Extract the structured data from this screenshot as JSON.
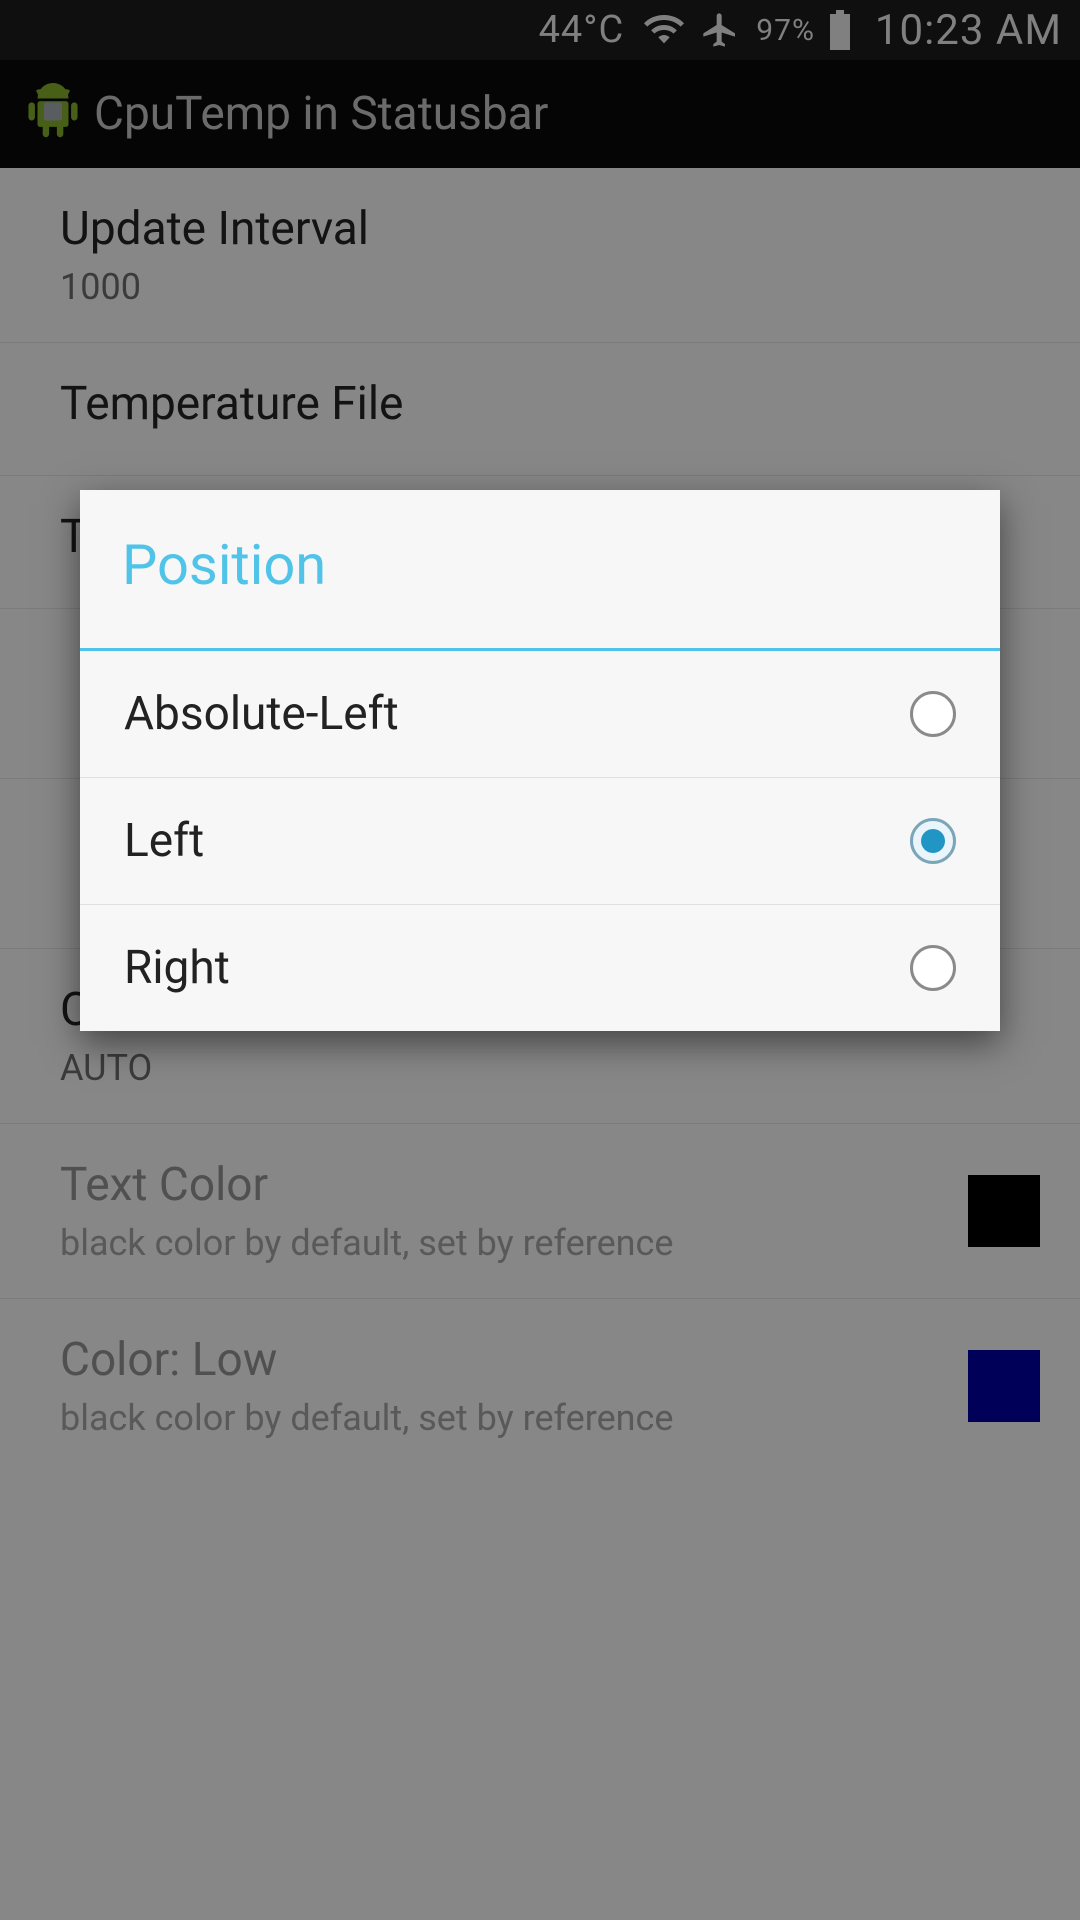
{
  "statusbar": {
    "temp": "44°C",
    "battery_pct": "97%",
    "clock": "10:23 AM"
  },
  "actionbar": {
    "title": "CpuTemp in Statusbar"
  },
  "settings": [
    {
      "label": "Update Interval",
      "value": "1000"
    },
    {
      "label": "Temperature File",
      "value": ""
    },
    {
      "label": "Temperature Divider",
      "value": ""
    },
    {
      "label": "",
      "value": ""
    },
    {
      "label": "",
      "value": ""
    },
    {
      "label": "Color-Mode",
      "value": "AUTO"
    },
    {
      "label": "Text Color",
      "value": "black color by default, set by reference",
      "swatch": "#000000",
      "disabled": true
    },
    {
      "label": "Color: Low",
      "value": "black color by default, set by reference",
      "swatch": "#000099",
      "disabled": true
    }
  ],
  "dialog": {
    "title": "Position",
    "options": [
      {
        "label": "Absolute-Left",
        "checked": false
      },
      {
        "label": "Left",
        "checked": true
      },
      {
        "label": "Right",
        "checked": false
      }
    ]
  }
}
